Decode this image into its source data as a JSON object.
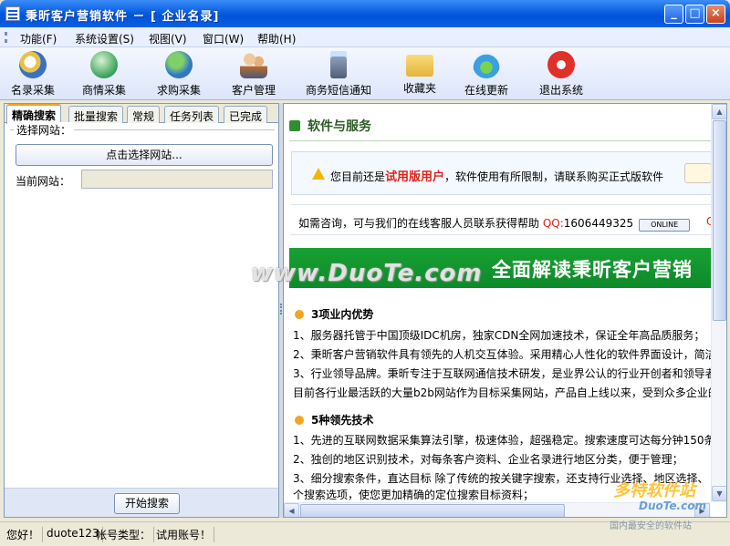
{
  "window": {
    "title": "秉昕客户营销软件 － [ 企业名录]",
    "buttons": {
      "minimize": "_",
      "maximize": "□",
      "close": "×"
    }
  },
  "menu": [
    "功能(F)",
    "系统设置(S)",
    "视图(V)",
    "窗口(W)",
    "帮助(H)"
  ],
  "toolbar": [
    {
      "label": "名录采集",
      "icon": "magnifier-icon",
      "color": "#3a6fc4"
    },
    {
      "label": "商情采集",
      "icon": "globe-search-icon",
      "color": "#36a056"
    },
    {
      "label": "求购采集",
      "icon": "globe-icon",
      "color": "#2f76c9"
    },
    {
      "label": "客户管理",
      "icon": "users-icon",
      "color": "#b86a2e"
    },
    {
      "label": "商务短信通知",
      "icon": "phone-icon",
      "color": "#6a7c99"
    },
    {
      "label": "收藏夹",
      "icon": "folder-icon",
      "color": "#e5b33a"
    },
    {
      "label": "在线更新",
      "icon": "update-icon",
      "color": "#3aa0e0"
    },
    {
      "label": "退出系统",
      "icon": "stop-icon",
      "color": "#e0302a"
    }
  ],
  "left": {
    "tabs": [
      "精确搜索",
      "批量搜索",
      "常规",
      "任务列表",
      "已完成"
    ],
    "active_tab": "精确搜索",
    "group_label": "选择网站：",
    "pick_button": "点击选择网站...",
    "site_label": "当前网站：",
    "site_value": "",
    "start_button": "开始搜索"
  },
  "right": {
    "section_title": "软件与服务",
    "notice_prefix": "您目前还是",
    "notice_trial": "试用版用户",
    "notice_suffix": "，软件使用有所限制，请联系购买正式版软件",
    "consult_text": "如需咨询，可与我们的在线客服人员联系获得帮助",
    "qq_label": "QQ:",
    "qq_number": "1606449325",
    "online_badge": "ONLINE",
    "qq_label2": "Q",
    "banner": "全面解读秉昕客户营销",
    "block1_title": "3项业内优势",
    "block1_lines": [
      "1、服务器托管于中国顶级IDC机房，独家CDN全网加速技术，保证全年高品质服务；",
      "2、秉昕客户营销软件具有领先的人机交互体验。采用精心人性化的软件界面设计，简洁",
      "3、行业领导品牌。秉昕专注于互联网通信技术研发，是业界公认的行业开创者和领导者",
      "目前各行业最活跃的大量b2b网站作为目标采集网站，产品自上线以来，受到众多企业的"
    ],
    "block2_title": "5种领先技术",
    "block2_lines": [
      "1、先进的互联网数据采集算法引擎，极速体验，超强稳定。搜索速度可达每分钟150条",
      "2、独创的地区识别技术，对每条客户资料、企业名录进行地区分类，便于管理；",
      "3、细分搜索条件，直达目标 除了传统的按关键字搜索，还支持行业选择、地区选择、",
      "个搜索选项，使您更加精确的定位搜索目标资料；"
    ]
  },
  "watermark": "www.DuoTe.com",
  "brand_watermark": {
    "line1": "多特软件站",
    "line2": "DuoTe.com",
    "line3": "国内最安全的软件站"
  },
  "status": {
    "greeting": "您好！",
    "user": "duote123",
    "account_type_label": "帐号类型：",
    "account_type": "试用账号！"
  }
}
